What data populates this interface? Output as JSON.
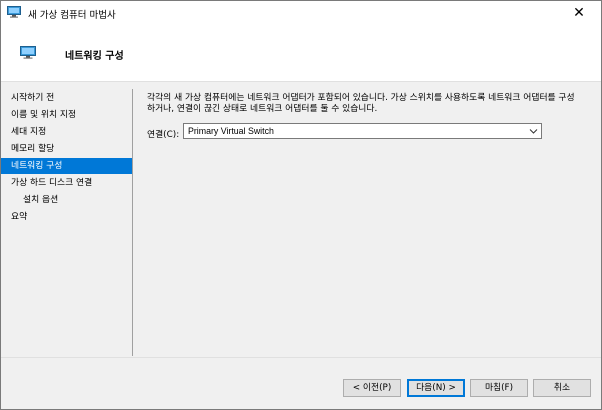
{
  "window": {
    "title": "새 가상 컴퓨터 마법사",
    "close_label": "✕"
  },
  "header": {
    "title": "네트워킹 구성"
  },
  "sidebar": {
    "items": [
      {
        "label": "시작하기 전",
        "selected": false,
        "sub": false
      },
      {
        "label": "이름 및 위치 지정",
        "selected": false,
        "sub": false
      },
      {
        "label": "세대 지정",
        "selected": false,
        "sub": false
      },
      {
        "label": "메모리 할당",
        "selected": false,
        "sub": false
      },
      {
        "label": "네트워킹 구성",
        "selected": true,
        "sub": false
      },
      {
        "label": "가상 하드 디스크 연결",
        "selected": false,
        "sub": false
      },
      {
        "label": "설치 옵션",
        "selected": false,
        "sub": true
      },
      {
        "label": "요약",
        "selected": false,
        "sub": false
      }
    ]
  },
  "main": {
    "description": "각각의 새 가상 컴퓨터에는 네트워크 어댑터가 포함되어 있습니다. 가상 스위치를 사용하도록 네트워크 어댑터를 구성\n하거나, 연결이 끊긴 상태로 네트워크 어댑터를 둘 수 있습니다.",
    "connection_label": "연결(C):",
    "connection_value": "Primary Virtual Switch"
  },
  "buttons": {
    "previous": "< 이전(P)",
    "next": "다음(N) >",
    "finish": "마침(F)",
    "cancel": "취소"
  },
  "colors": {
    "accent": "#0078d7",
    "background": "#f0f0f0"
  }
}
